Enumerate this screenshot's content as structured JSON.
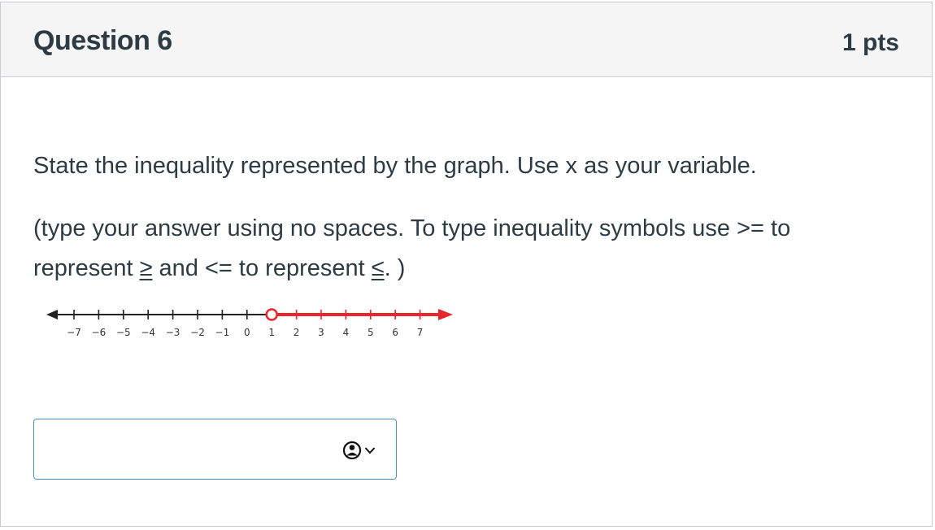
{
  "question": {
    "title": "Question 6",
    "points": "1 pts",
    "prompt": "State the inequality represented by the graph. Use x as your variable.",
    "instructions": {
      "part1": "(type your answer using no spaces. To type inequality symbols use >= to represent ",
      "ge_symbol": "≥",
      "part2": " and <= to represent ",
      "le_symbol": "≤",
      "part3": ".  )"
    }
  },
  "number_line": {
    "tick_labels": [
      "-7",
      "-6",
      "-5",
      "-4",
      "-3",
      "-2",
      "-1",
      "0",
      "1",
      "2",
      "3",
      "4",
      "5",
      "6",
      "7"
    ],
    "endpoint": 1,
    "endpoint_style": "open",
    "direction": "right",
    "shade_color": "#e8262b"
  },
  "answer_field": {
    "value": "",
    "accessibility_icon": "accessibility-person-icon"
  }
}
